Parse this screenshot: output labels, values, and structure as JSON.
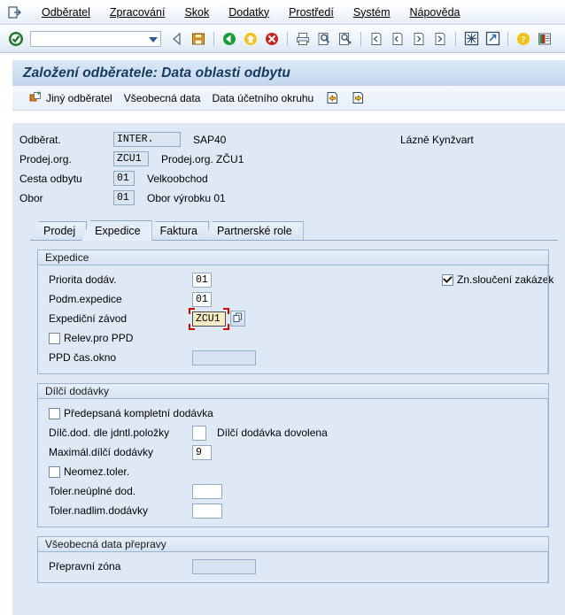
{
  "menu": {
    "system_icon": "exit-arrow-icon",
    "items": [
      {
        "label": "Odběratel",
        "accel_index": 0
      },
      {
        "label": "Zpracování",
        "accel_index": 0
      },
      {
        "label": "Skok",
        "accel_index": 1
      },
      {
        "label": "Dodatky",
        "accel_index": 0
      },
      {
        "label": "Prostředí",
        "accel_index": 0
      },
      {
        "label": "Systém",
        "accel_index": 1
      },
      {
        "label": "Nápověda",
        "accel_index": 0
      }
    ]
  },
  "toolbar": {
    "command_field_value": "",
    "command_field_placeholder": "",
    "icons": [
      "enter-check-icon",
      "back-arrow-icon",
      "save-icon",
      "back-green-icon",
      "exit-yellow-icon",
      "cancel-red-icon",
      "print-icon",
      "find-icon",
      "find-next-icon",
      "first-page-icon",
      "previous-page-icon",
      "next-page-icon",
      "last-page-icon",
      "new-session-icon",
      "create-shortcut-icon",
      "help-icon",
      "customize-layout-icon"
    ]
  },
  "title": "Založení odběratele: Data oblasti odbytu",
  "app_toolbar": {
    "buttons": [
      {
        "label": "Jiný odběratel",
        "icon": "other-customer-icon"
      },
      {
        "label": "Všeobecná data",
        "icon": ""
      },
      {
        "label": "Data účetního okruhu",
        "icon": ""
      }
    ],
    "nav_icons": [
      "previous-screen-icon",
      "next-screen-icon"
    ]
  },
  "header_fields": [
    {
      "label": "Odběrat.",
      "value": "INTER.",
      "desc": "SAP40",
      "width": "w76"
    },
    {
      "label": "Prodej.org.",
      "value": "ZCU1",
      "desc": "Prodej.org. ZČU1",
      "width": "w5"
    },
    {
      "label": "Cesta odbytu",
      "value": "01",
      "desc": "Velkoobchod",
      "width": "w2"
    },
    {
      "label": "Obor",
      "value": "01",
      "desc": "Obor výrobku 01",
      "width": "w2"
    }
  ],
  "header_right_text": "Lázně Kynžvart",
  "tabs": [
    {
      "label": "Prodej",
      "active": false
    },
    {
      "label": "Expedice",
      "active": true
    },
    {
      "label": "Faktura",
      "active": false
    },
    {
      "label": "Partnerské role",
      "active": false
    }
  ],
  "sections": {
    "expedice": {
      "title": "Expedice",
      "priorita_label": "Priorita dodáv.",
      "priorita_value": "01",
      "podm_label": "Podm.expedice",
      "podm_value": "01",
      "zavod_label": "Expediční závod",
      "zavod_value": "ZCU1",
      "matchcode_icon": "matchcode-icon",
      "relev_ppd_label": "Relev.pro PPD",
      "relev_ppd_checked": false,
      "ppd_okno_label": "PPD čas.okno",
      "ppd_okno_value": "",
      "zn_slouceni_label": "Zn.sloučení zakázek",
      "zn_slouceni_checked": true
    },
    "dilci": {
      "title": "Dílčí dodávky",
      "predepsana_label": "Předepsaná kompletní dodávka",
      "predepsana_checked": false,
      "dilc_dod_label": "Dílč.dod. dle jdntl.položky",
      "dilc_dod_value": "",
      "dilc_dod_desc": "Dílčí dodávka dovolena",
      "maximal_label": "Maximál.dílčí dodávky",
      "maximal_value": "9",
      "neomez_label": "Neomez.toler.",
      "neomez_checked": false,
      "toler_neuplne_label": "Toler.neúplné dod.",
      "toler_neuplne_value": "",
      "toler_nadlim_label": "Toler.nadlim.dodávky",
      "toler_nadlim_value": ""
    },
    "preprava": {
      "title": "Všeobecná data přepravy",
      "zona_label": "Přepravní zóna",
      "zona_value": ""
    }
  },
  "colors": {
    "canvas_bg": "#dfe9f5",
    "title_text": "#14385e",
    "focus_field_bg": "#f6edc4",
    "focus_marker": "#e00000",
    "readonly_bg": "#dbe5f0",
    "border": "#8fa9c2"
  }
}
